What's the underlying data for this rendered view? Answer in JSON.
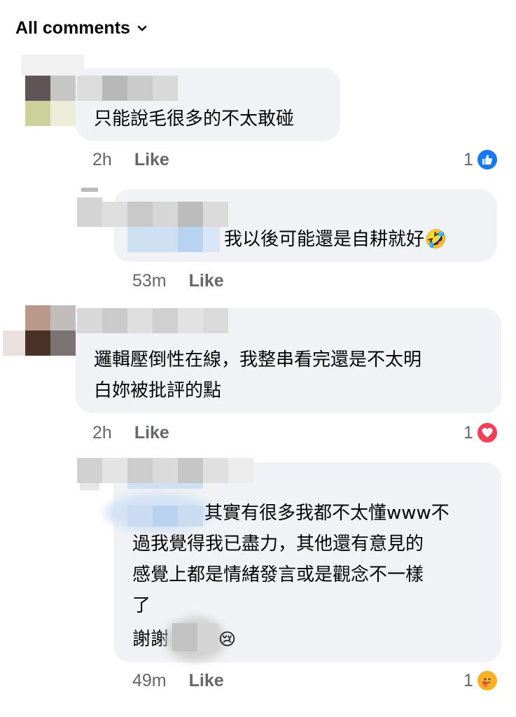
{
  "header": {
    "title": "All comments"
  },
  "comments": [
    {
      "text": "只能說毛很多的不太敢碰",
      "time": "2h",
      "like_label": "Like",
      "reaction_count": "1",
      "reaction_type": "like"
    },
    {
      "text": "我以後可能還是自耕就好🤣",
      "time": "53m",
      "like_label": "Like"
    },
    {
      "text_lines": [
        "邏輯壓倒性在線，我整串看完還是不太明",
        "白妳被批評的點"
      ],
      "time": "2h",
      "like_label": "Like",
      "reaction_count": "1",
      "reaction_type": "love"
    },
    {
      "text_lines": [
        "其實有很多我都不太懂www不",
        "過我覺得我已盡力，其他還有意見的",
        "感覺上都是情緒發言或是觀念不一樣",
        "了",
        "謝謝"
      ],
      "emoji_tail": "😢",
      "time": "49m",
      "like_label": "Like",
      "reaction_count": "1",
      "reaction_type": "care"
    }
  ],
  "colors": {
    "bubble": "#f0f2f5",
    "meta": "#65676b",
    "like_blue": "#1877f2",
    "love_red": "#f33e58",
    "care_yellow": "#f7b125"
  }
}
